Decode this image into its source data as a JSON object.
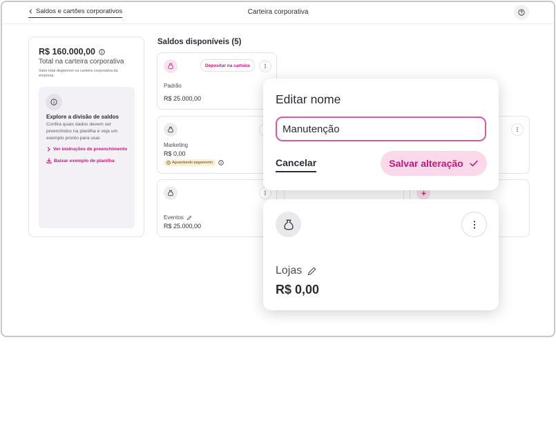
{
  "header": {
    "back_label": "Saldos e cartões corporativos",
    "title": "Carteira corporativa"
  },
  "summary": {
    "amount": "R$ 160.000,00",
    "subtitle": "Total na carteira corporativa",
    "note": "Valor total disponível na carteira corporativa da empresa.",
    "explore": {
      "title": "Explore a divisão de saldos",
      "text": "Confira quais dados devem ser preenchidos na planilha e veja um exemplo pronto para usar.",
      "link_instructions": "Ver instruções de preenchimento",
      "link_download": "Baixar exemplo de planilha"
    }
  },
  "balances": {
    "title": "Saldos disponíveis (5)",
    "deposit_label": "Depositar na carteira",
    "cards": [
      {
        "name": "Padrão",
        "value": "R$ 25.000,00"
      },
      {
        "name": "Marketing",
        "value": "R$ 0,00",
        "status": "Aguardando pagamento"
      },
      {
        "name": "Eventos",
        "value": "R$ 25.000,00"
      }
    ]
  },
  "edit_dialog": {
    "title": "Editar nome",
    "input_value": "Manutenção",
    "cancel_label": "Cancelar",
    "save_label": "Salvar alteração"
  },
  "lojas_card": {
    "name": "Lojas",
    "value": "R$ 0,00"
  },
  "colors": {
    "accent": "#c2177a",
    "accent_light": "#fbd9ea",
    "input_border": "#e0569d",
    "status_bg": "#fdf0d3"
  }
}
